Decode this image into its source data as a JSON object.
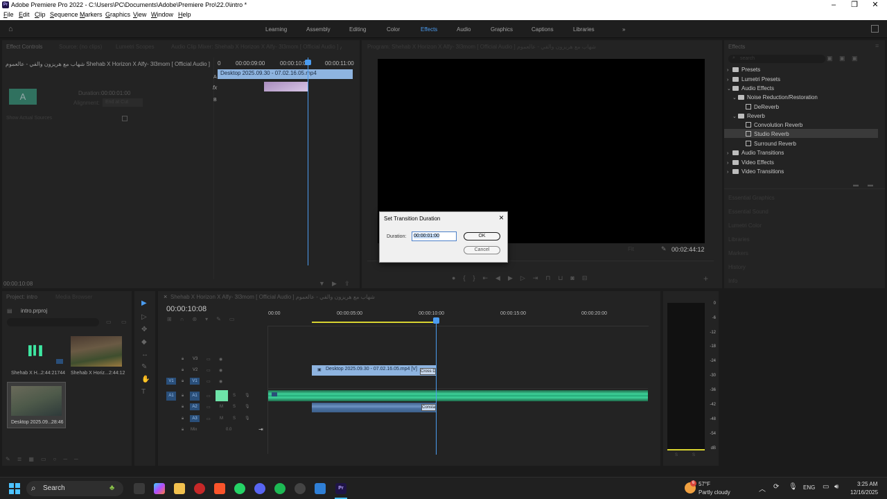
{
  "window": {
    "title": "Adobe Premiere Pro 2022 - C:\\Users\\PC\\Documents\\Adobe\\Premiere Pro\\22.0\\intro *",
    "app_icon": "Pr"
  },
  "menu": [
    "File",
    "Edit",
    "Clip",
    "Sequence",
    "Markers",
    "Graphics",
    "View",
    "Window",
    "Help"
  ],
  "workspaces": [
    {
      "label": "Learning",
      "active": false
    },
    {
      "label": "Assembly",
      "active": false
    },
    {
      "label": "Editing",
      "active": false
    },
    {
      "label": "Color",
      "active": false
    },
    {
      "label": "Effects",
      "active": true
    },
    {
      "label": "Audio",
      "active": false
    },
    {
      "label": "Graphics",
      "active": false
    },
    {
      "label": "Captions",
      "active": false
    },
    {
      "label": "Libraries",
      "active": false
    }
  ],
  "source_panel": {
    "tabs": [
      "Effect Controls",
      "Source: (no clips)",
      "Lumetri Scopes",
      "Audio Clip Mixer: Shehab X Horizon X Alfy- 3l3mom [ Official Audio ] عالعموم"
    ],
    "clip_name": "شهاب مع هريزون والفي - عالعموم Shehab X Horizon X Alfy- 3l3mom [ Official Audio ]",
    "duration_label": "Duration:",
    "duration_value": "00:00:01:00",
    "alignment_label": "Alignment:",
    "alignment_value": "End at Cut",
    "show_sources": "Show Actual Sources",
    "ruler": [
      "0",
      "00:00:09:00",
      "00:00:10:00",
      "00:00:11:00"
    ],
    "clip_a": "Desktop 2025.09.30 - 07.02.16.05.mp4",
    "track_a": "A",
    "track_b": "B",
    "fx": "fx",
    "timecode": "00:00:10:08"
  },
  "program": {
    "title": "Program: Shehab X Horizon X Alfy- 3l3mom [ Official Audio ] شهاب مع هريزون والفي - عالعموم",
    "fit": "Fit",
    "duration": "00:02:44:12"
  },
  "effects": {
    "tab": "Effects",
    "search_placeholder": "search",
    "tree": [
      {
        "label": "Presets",
        "level": 0,
        "kind": "folder",
        "arrow": "›"
      },
      {
        "label": "Lumetri Presets",
        "level": 0,
        "kind": "folder",
        "arrow": "›"
      },
      {
        "label": "Audio Effects",
        "level": 0,
        "kind": "folder",
        "arrow": "⌄"
      },
      {
        "label": "Noise Reduction/Restoration",
        "level": 1,
        "kind": "folder",
        "arrow": "⌄"
      },
      {
        "label": "DeReverb",
        "level": 2,
        "kind": "fx",
        "arrow": ""
      },
      {
        "label": "Reverb",
        "level": 1,
        "kind": "folder",
        "arrow": "⌄"
      },
      {
        "label": "Convolution Reverb",
        "level": 2,
        "kind": "fx",
        "arrow": ""
      },
      {
        "label": "Studio Reverb",
        "level": 2,
        "kind": "fx",
        "arrow": "",
        "selected": true
      },
      {
        "label": "Surround Reverb",
        "level": 2,
        "kind": "fx",
        "arrow": ""
      },
      {
        "label": "Audio Transitions",
        "level": 0,
        "kind": "folder",
        "arrow": "›"
      },
      {
        "label": "Video Effects",
        "level": 0,
        "kind": "folder",
        "arrow": "›"
      },
      {
        "label": "Video Transitions",
        "level": 0,
        "kind": "folder",
        "arrow": "›"
      }
    ],
    "collapsed_panels": [
      "Essential Graphics",
      "Essential Sound",
      "Lumetri Color",
      "Libraries",
      "Markers",
      "History",
      "Info"
    ]
  },
  "dialog": {
    "title": "Set Transition Duration",
    "duration_label": "Duration:",
    "duration_value": "00:00:01:00",
    "ok": "OK",
    "cancel": "Cancel"
  },
  "project": {
    "tabs": [
      "Project: intro",
      "Media Browser"
    ],
    "file": "intro.prproj",
    "items": [
      {
        "name": "Shehab X H...",
        "duration": "2:44:21744"
      },
      {
        "name": "Shehab X Horiz...",
        "duration": "2:44:12"
      },
      {
        "name": "Desktop 2025.09...",
        "duration": "28:46"
      }
    ]
  },
  "timeline": {
    "tab": "Shehab X Horizon X Alfy- 3l3mom [ Official Audio ] شهاب مع هريزون والفي - عالعموم",
    "timecode": "00:00:10:08",
    "ruler": [
      "00:00",
      "00:00:05:00",
      "00:00:10:00",
      "00:00:15:00",
      "00:00:20:00"
    ],
    "video_tracks": [
      "V3",
      "V2",
      "V1"
    ],
    "audio_tracks": [
      "A1",
      "A2",
      "A3"
    ],
    "source_v": "V1",
    "source_a": "A1",
    "mix": "Mix",
    "mix_value": "0.0",
    "clip_v2": "Desktop 2025.09.30 - 07.02.16.05.mp4 [V]",
    "cross_v": "Cross D",
    "cross_a": "Consta"
  },
  "meter": {
    "scale": [
      "0",
      "-6",
      "-12",
      "-18",
      "-24",
      "-30",
      "-36",
      "-42",
      "-48",
      "-54",
      "dB"
    ],
    "bottom": [
      "S",
      "S"
    ]
  },
  "taskbar": {
    "search": "Search",
    "weather_temp": "57°F",
    "weather_desc": "Partly cloudy",
    "lang": "ENG",
    "time": "3:25 AM",
    "date": "12/16/2025",
    "badge": "6"
  }
}
